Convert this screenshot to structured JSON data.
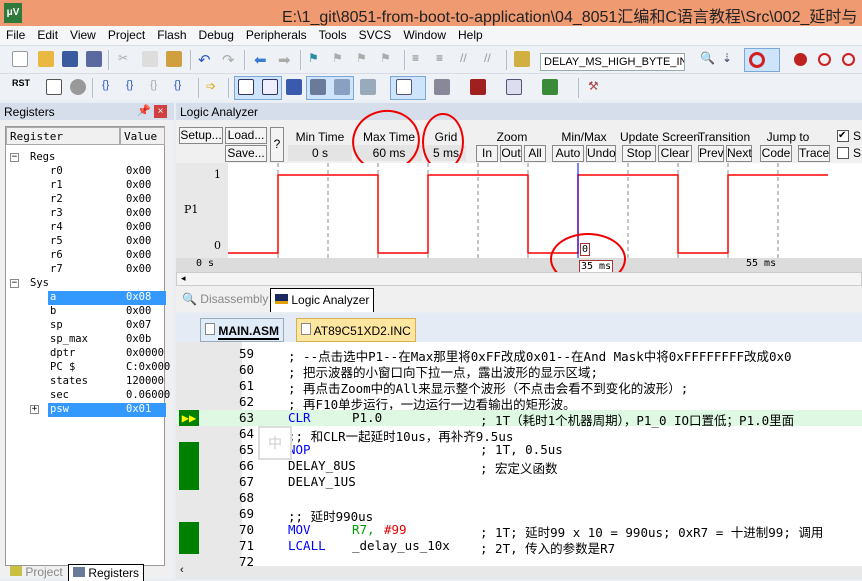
{
  "title": "E:\\1_git\\8051-from-boot-to-application\\04_8051汇编和C语言教程\\Src\\002_延时与",
  "menu": [
    "File",
    "Edit",
    "View",
    "Project",
    "Flash",
    "Debug",
    "Peripherals",
    "Tools",
    "SVCS",
    "Window",
    "Help"
  ],
  "toolbar": {
    "combo_value": "DELAY_MS_HIGH_BYTE_IN",
    "rst_label": "RST"
  },
  "registers": {
    "title": "Registers",
    "col_register": "Register",
    "col_value": "Value",
    "groups": [
      {
        "name": "Regs",
        "items": [
          {
            "n": "r0",
            "v": "0x00"
          },
          {
            "n": "r1",
            "v": "0x00"
          },
          {
            "n": "r2",
            "v": "0x00"
          },
          {
            "n": "r3",
            "v": "0x00"
          },
          {
            "n": "r4",
            "v": "0x00"
          },
          {
            "n": "r5",
            "v": "0x00"
          },
          {
            "n": "r6",
            "v": "0x00"
          },
          {
            "n": "r7",
            "v": "0x00"
          }
        ]
      },
      {
        "name": "Sys",
        "items": [
          {
            "n": "a",
            "v": "0x08",
            "selected": true
          },
          {
            "n": "b",
            "v": "0x00"
          },
          {
            "n": "sp",
            "v": "0x07"
          },
          {
            "n": "sp_max",
            "v": "0x0b"
          },
          {
            "n": "dptr",
            "v": "0x0000"
          },
          {
            "n": "PC  $",
            "v": "C:0x000"
          },
          {
            "n": "states",
            "v": "120000"
          },
          {
            "n": "sec",
            "v": "0.06000"
          },
          {
            "n": "psw",
            "v": "0x01",
            "selected": true,
            "expandable": true
          }
        ]
      }
    ],
    "bottom_tabs": [
      "Project",
      "Registers"
    ]
  },
  "logic_analyzer": {
    "title": "Logic Analyzer",
    "setup": "Setup...",
    "load": "Load...",
    "save": "Save...",
    "help": "?",
    "min_time_label": "Min Time",
    "min_time": "0 s",
    "max_time_label": "Max Time",
    "max_time": "60 ms",
    "grid_label": "Grid",
    "grid": "5 ms",
    "zoom_label": "Zoom",
    "zoom_in": "In",
    "zoom_out": "Out",
    "zoom_all": "All",
    "minmax_label": "Min/Max",
    "auto": "Auto",
    "undo": "Undo",
    "update_label": "Update Screen",
    "stop": "Stop",
    "clear": "Clear",
    "transition_label": "Transition",
    "prev": "Prev",
    "next": "Next",
    "jump_label": "Jump to",
    "code": "Code",
    "trace": "Trace",
    "check1": "S",
    "check2": "S",
    "signal": "P1",
    "high": "1",
    "low": "0",
    "axis_start": "0 s",
    "axis_mark": "55 ms",
    "cursor_time": "35 ms",
    "cursor_value": "0",
    "wave_color": "#ff0000",
    "waveform_ms": [
      [
        0,
        0
      ],
      [
        5,
        1
      ],
      [
        15,
        0
      ],
      [
        20,
        1
      ],
      [
        30,
        0
      ],
      [
        35,
        1
      ],
      [
        45,
        0
      ],
      [
        50,
        1
      ],
      [
        60,
        1
      ]
    ],
    "cursor_ms": 35,
    "view_ms": [
      0,
      60
    ],
    "tabs": [
      "Disassembly",
      "Logic Analyzer"
    ]
  },
  "editor": {
    "tabs": [
      "MAIN.ASM",
      "AT89C51XD2.INC"
    ],
    "lines": [
      {
        "no": "59",
        "code": "; --点击选中P1--在Max那里将0xFF改成0x01--在And Mask中将0xFFFFFFFF改成0x0"
      },
      {
        "no": "60",
        "code": "; 把示波器的小窗口向下拉一点，露出波形的显示区域;"
      },
      {
        "no": "61",
        "code": "; 再点击Zoom中的All来显示整个波形（不点击会看不到变化的波形）;"
      },
      {
        "no": "62",
        "code": "; 再F10单步运行，一边运行一边看输出的矩形波。"
      },
      {
        "no": "63",
        "op": "CLR",
        "arg": "P1.0",
        "comment": "; 1T（耗时1个机器周期），P1_0 IO口置低；P1.0里面"
      },
      {
        "no": "64",
        "code": ";; 和CLR一起延时10us，再补齐9.5us"
      },
      {
        "no": "65",
        "op": "NOP",
        "arg": "",
        "comment": "; 1T, 0.5us"
      },
      {
        "no": "66",
        "code": "DELAY_8US",
        "comment": "; 宏定义函数"
      },
      {
        "no": "67",
        "code": "DELAY_1US"
      },
      {
        "no": "68",
        "code": ""
      },
      {
        "no": "69",
        "code": ";; 延时990us"
      },
      {
        "no": "70",
        "op": "MOV",
        "reg": "R7,",
        "imm": "#99",
        "comment": "; 1T; 延时99 x 10 = 990us; 0xR7 = 十进制99; 调用"
      },
      {
        "no": "71",
        "op": "LCALL",
        "arg": "_delay_us_10x",
        "comment": "; 2T, 传入的参数是R7"
      },
      {
        "no": "72",
        "code": ""
      }
    ],
    "ime_label": "中"
  }
}
